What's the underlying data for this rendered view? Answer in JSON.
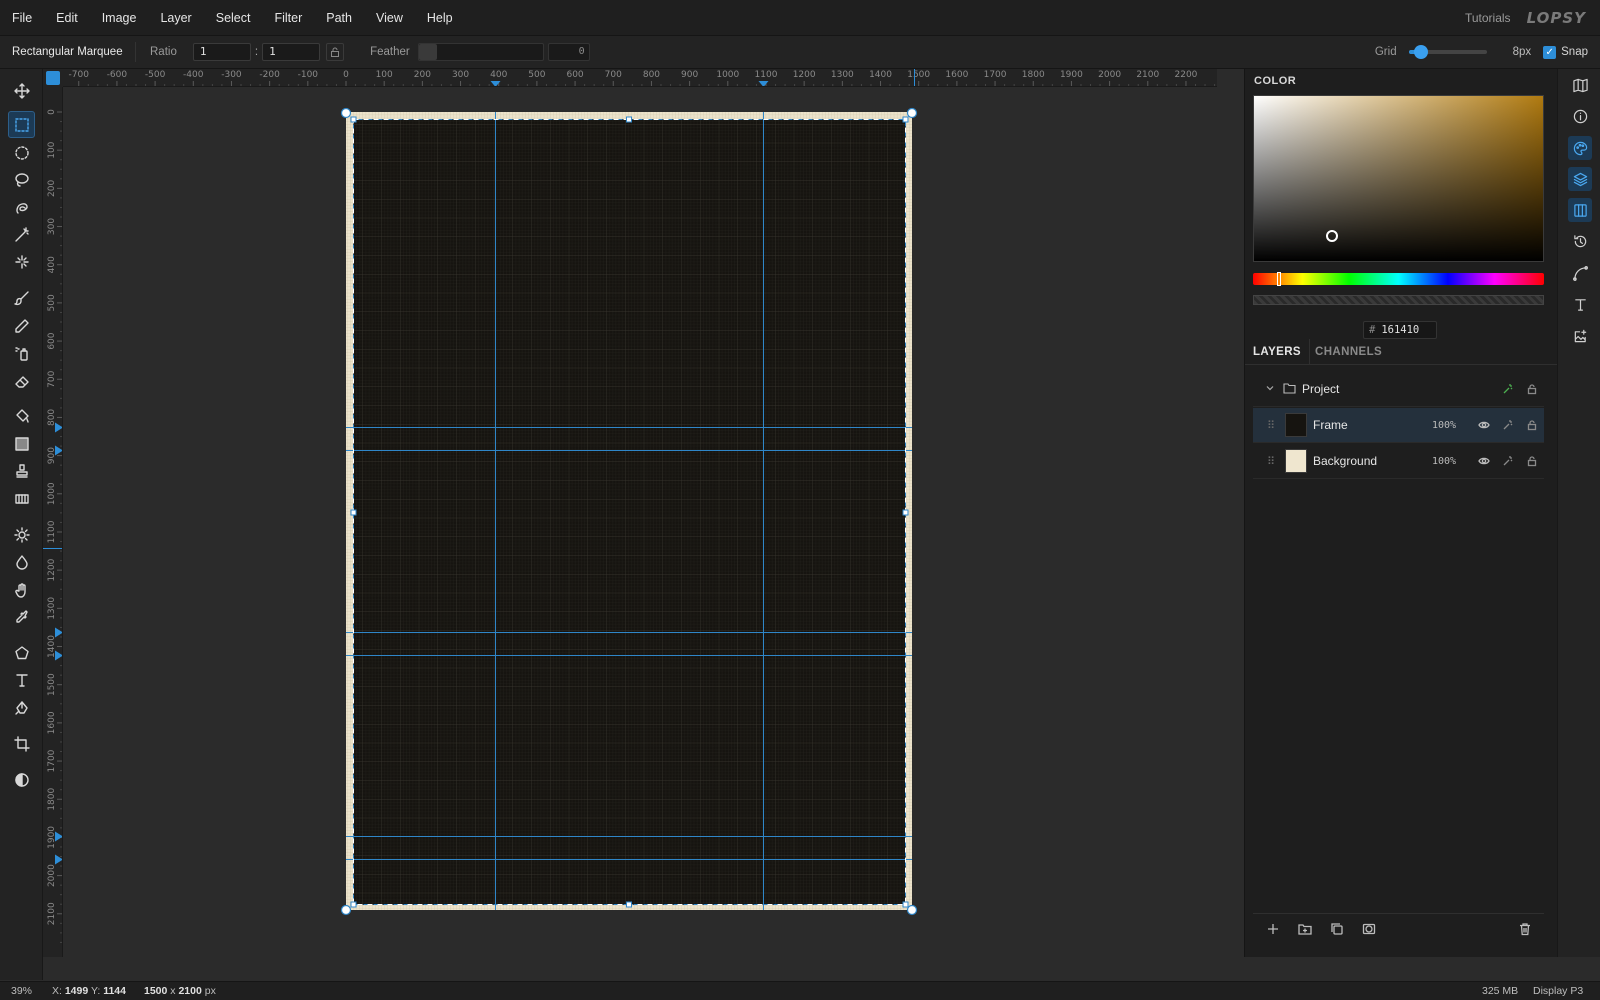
{
  "menubar": {
    "items": [
      "File",
      "Edit",
      "Image",
      "Layer",
      "Select",
      "Filter",
      "Path",
      "View",
      "Help"
    ],
    "tutorials": "Tutorials",
    "logo": "LOPSY"
  },
  "options": {
    "tool_name": "Rectangular Marquee",
    "ratio_label": "Ratio",
    "ratio_w": "1",
    "ratio_h": "1",
    "ratio_sep": ":",
    "feather_label": "Feather",
    "feather_value": "0",
    "grid_label": "Grid",
    "grid_value": 0.16,
    "grid_size": "8px",
    "snap_label": "Snap",
    "snap_checked": true
  },
  "tools": [
    "move-icon",
    "rect-marquee-icon",
    "ellipse-marquee-icon",
    "lasso-icon",
    "magnetic-lasso-icon",
    "magic-wand-icon",
    "quick-select-icon",
    "brush-icon",
    "pencil-icon",
    "spray-icon",
    "eraser-icon",
    "paint-bucket-icon",
    "gradient-icon",
    "stamp-icon",
    "pattern-icon",
    "dodge-icon",
    "blur-icon",
    "hand-icon",
    "eyedropper-icon",
    "polygon-icon",
    "text-icon",
    "pen-icon",
    "crop-icon",
    "contrast-icon"
  ],
  "ruler_top": [
    "-700",
    "-600",
    "-500",
    "-400",
    "-300",
    "-200",
    "-100",
    "0",
    "100",
    "200",
    "300",
    "400",
    "500",
    "600",
    "700",
    "800",
    "900",
    "1000",
    "1100",
    "1200",
    "1300",
    "1400",
    "1500",
    "1600",
    "1700",
    "1800",
    "1900",
    "2000",
    "2100",
    "2200"
  ],
  "ruler_left": [
    "0",
    "100",
    "200",
    "300",
    "400",
    "500",
    "600",
    "700",
    "800",
    "900",
    "1000",
    "1100",
    "1200",
    "1300",
    "1400",
    "1500",
    "1600",
    "1700",
    "1800",
    "1900",
    "2000",
    "2100"
  ],
  "color_panel": {
    "title": "COLOR",
    "hex_hash": "#",
    "hex": "161410",
    "hue_value": 0.09
  },
  "layers_panel": {
    "tab_layers": "LAYERS",
    "tab_channels": "CHANNELS",
    "group_name": "Project",
    "layers": [
      {
        "name": "Frame",
        "opacity": "100%",
        "selected": true
      },
      {
        "name": "Background",
        "opacity": "100%",
        "selected": false
      }
    ]
  },
  "status": {
    "zoom": "39%",
    "x_label": "X:",
    "x": "1499",
    "y_label": "Y:",
    "y": "1144",
    "doc_w": "1500",
    "doc_x": "x",
    "doc_h": "2100",
    "doc_unit": "px",
    "memory": "325 MB",
    "color_profile": "Display P3"
  },
  "colors": {
    "accent": "#2d8ed8",
    "canvas_fill": "#161410",
    "paper": "#efe6cf",
    "guide": "#2f86c8"
  }
}
